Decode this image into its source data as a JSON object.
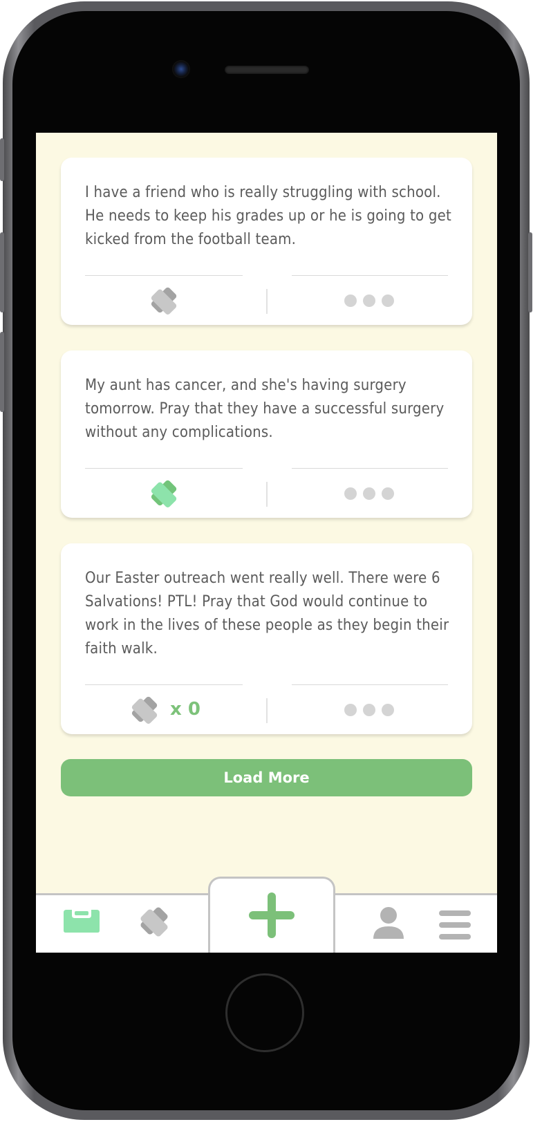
{
  "theme": {
    "screen_bg": "#fcf9e3",
    "accent_green": "#7dc27a",
    "prayed_green": "#8de3ab",
    "icon_gray": "#b9b9b9",
    "text_color": "#5b5b5b"
  },
  "feed": {
    "posts": [
      {
        "text": "I have a friend who is really struggling with school. He needs to keep his grades up or he is going to get kicked from the football team.",
        "prayed": false,
        "pray_icon": "praying-hands-icon",
        "more_icon": "more-dots-icon"
      },
      {
        "text": "My aunt has cancer, and she's having surgery tomorrow. Pray that they have a successful surgery without any complications.",
        "prayed": true,
        "pray_icon": "praying-hands-icon",
        "more_icon": "more-dots-icon"
      },
      {
        "text": "Our Easter outreach went really well. There were 6 Salvations! PTL! Pray that God would continue to work in the lives of these people as they begin their faith walk.",
        "prayed": false,
        "pray_count": "x 0",
        "pray_icon": "praying-hands-icon",
        "more_icon": "more-dots-icon"
      }
    ],
    "load_more_label": "Load More"
  },
  "tabbar": {
    "items": [
      {
        "icon": "inbox-tray-icon",
        "active": true
      },
      {
        "icon": "praying-hands-icon",
        "active": false
      },
      {
        "icon": "plus-icon",
        "active": false
      },
      {
        "icon": "user-profile-icon",
        "active": false
      },
      {
        "icon": "hamburger-menu-icon",
        "active": false
      }
    ]
  }
}
